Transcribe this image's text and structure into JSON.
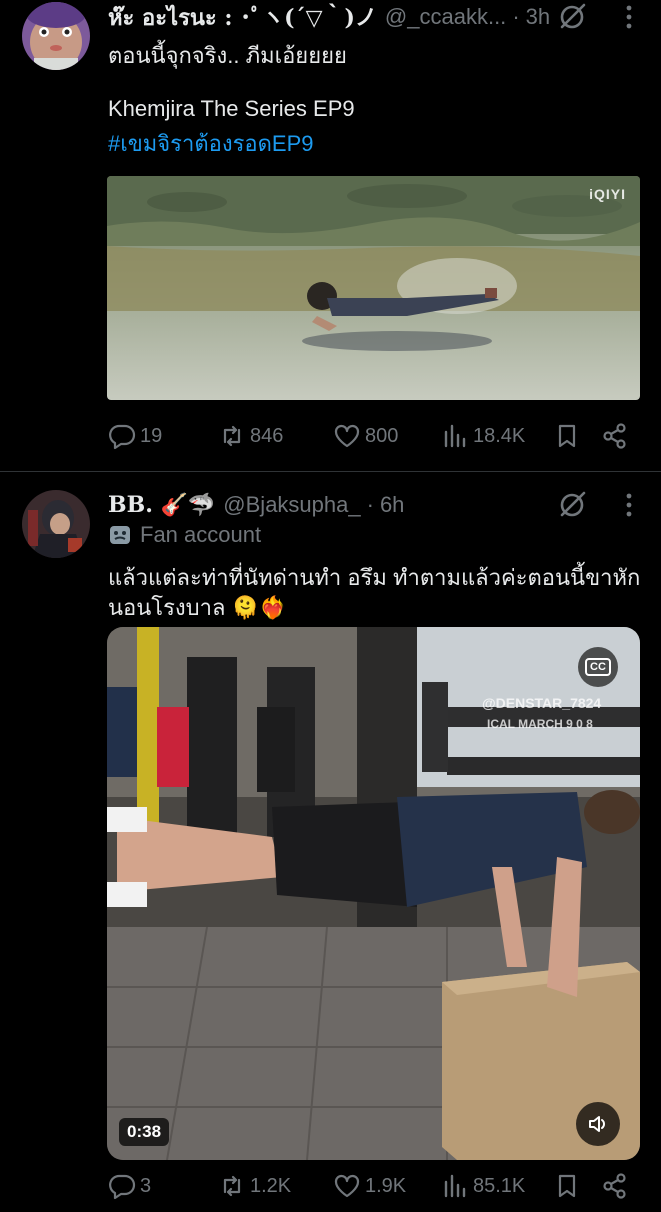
{
  "tweets": [
    {
      "display_name": "ห๊ะ อะไรนะ : ･ﾟヽ(´▽｀)ノ",
      "handle": "@_ccaakk...",
      "separator": "·",
      "time": "3h",
      "text_lines": [
        "ตอนนี้จุกจริง.. ภีมเอ้ยยยย",
        "Khemjira The Series EP9"
      ],
      "hashtag": "#เขมจิราต้องรอดEP9",
      "media_watermark": "iQIYI",
      "stats": {
        "replies": "19",
        "reposts": "846",
        "likes": "800",
        "views": "18.4K"
      }
    },
    {
      "display_name": "BB. 🎸🦈",
      "handle": "@Bjaksupha_",
      "separator": "·",
      "time": "6h",
      "badge": "Fan account",
      "text_lines": [
        "แล้วแต่ละท่าที่นัทด่านทำ อรึม ทำตามแล้วค่ะตอนนี้ขาหัก",
        "นอนโรงบาล 🫠❤️‍🔥"
      ],
      "media_overlay_handle": "@DENSTAR_7824",
      "media_overlay_date": "ICAL MARCH 9 0 8",
      "video_time": "0:38",
      "stats": {
        "replies": "3",
        "reposts": "1.2K",
        "likes": "1.9K",
        "views": "85.1K"
      }
    }
  ],
  "colors": {
    "accent": "#1d9bf0",
    "muted": "#71767b",
    "text": "#e7e9ea",
    "background": "#000000"
  },
  "icons": [
    "reply-icon",
    "repost-icon",
    "like-icon",
    "views-icon",
    "bookmark-icon",
    "share-icon",
    "grok-icon",
    "more-icon",
    "fan-mask-icon",
    "volume-icon",
    "cc-icon"
  ]
}
